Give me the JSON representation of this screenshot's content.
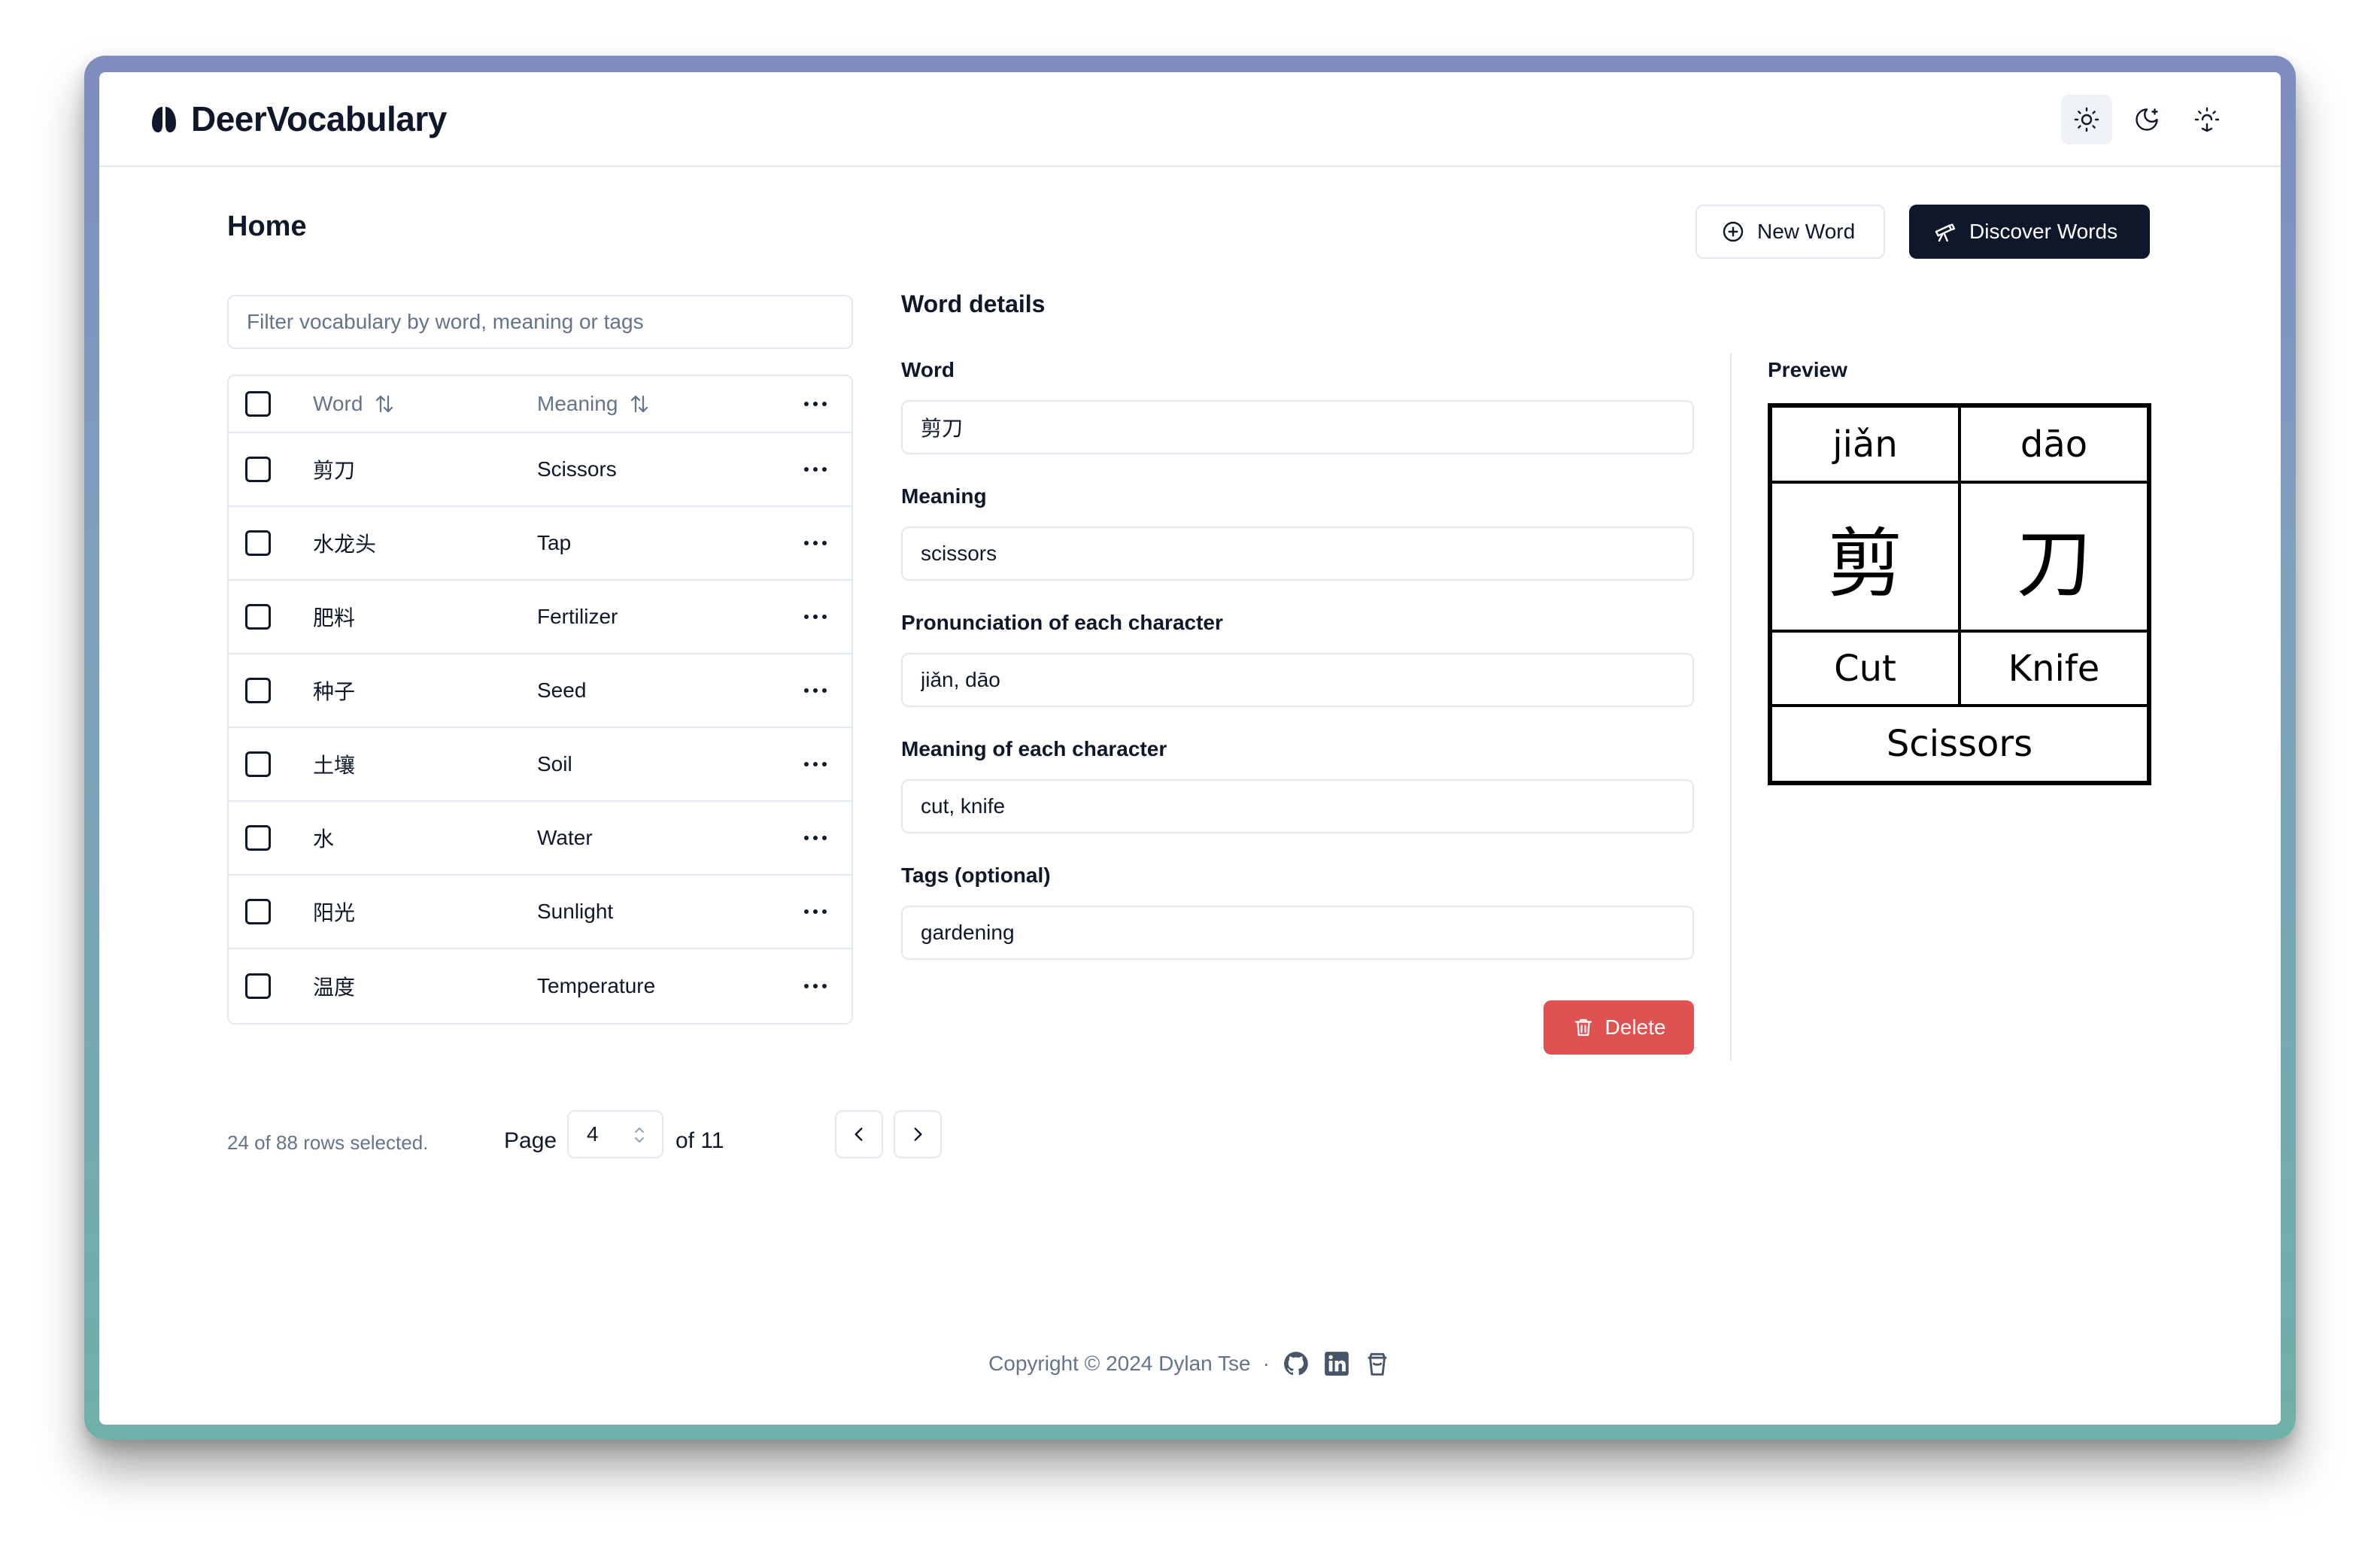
{
  "app": {
    "brand": "DeerVocabulary"
  },
  "header": {
    "theme_buttons": [
      "sun-icon",
      "moon-icon",
      "system-sun-icon"
    ]
  },
  "page": {
    "title": "Home",
    "new_word_label": "New Word",
    "discover_label": "Discover Words"
  },
  "filter": {
    "placeholder": "Filter vocabulary by word, meaning or tags",
    "value": ""
  },
  "table": {
    "headers": {
      "word": "Word",
      "meaning": "Meaning"
    },
    "rows": [
      {
        "word": "剪刀",
        "meaning": "Scissors"
      },
      {
        "word": "水龙头",
        "meaning": "Tap"
      },
      {
        "word": "肥料",
        "meaning": "Fertilizer"
      },
      {
        "word": "种子",
        "meaning": "Seed"
      },
      {
        "word": "土壤",
        "meaning": "Soil"
      },
      {
        "word": "水",
        "meaning": "Water"
      },
      {
        "word": "阳光",
        "meaning": "Sunlight"
      },
      {
        "word": "温度",
        "meaning": "Temperature"
      }
    ]
  },
  "pagination": {
    "selected_info": "24 of 88 rows selected.",
    "page_label": "Page",
    "current_page": "4",
    "of_label": "of 11"
  },
  "details": {
    "title": "Word details",
    "word_label": "Word",
    "word_value": "剪刀",
    "meaning_label": "Meaning",
    "meaning_value": "scissors",
    "pronunciation_label": "Pronunciation of each character",
    "pronunciation_value": "jiǎn, dāo",
    "char_meaning_label": "Meaning of each character",
    "char_meaning_value": "cut, knife",
    "tags_label": "Tags (optional)",
    "tags_value": "gardening",
    "delete_label": "Delete"
  },
  "preview": {
    "label": "Preview",
    "pinyin": [
      "jiǎn",
      "dāo"
    ],
    "characters": [
      "剪",
      "刀"
    ],
    "char_meanings": [
      "Cut",
      "Knife"
    ],
    "word_meaning": "Scissors"
  },
  "footer": {
    "copyright": "Copyright © 2024 Dylan Tse",
    "separator": "·",
    "links": [
      "github-icon",
      "linkedin-icon",
      "coffee-cup-icon"
    ]
  },
  "colors": {
    "primary_dark": "#0f172a",
    "muted_text": "#64748b",
    "border": "#e2e8f0",
    "danger": "#e05252"
  }
}
